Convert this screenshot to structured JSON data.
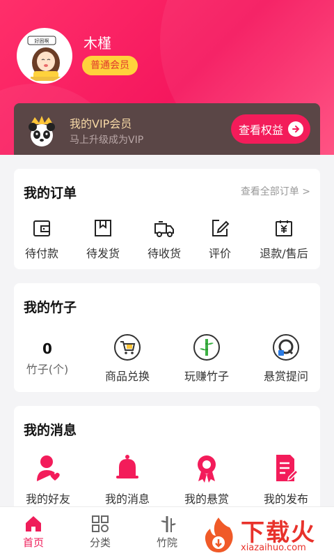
{
  "profile": {
    "username": "木槿",
    "level_badge": "普通会员",
    "avatar_caption": "好困啊"
  },
  "vip": {
    "title": "我的VIP会员",
    "subtitle": "马上升级成为VIP",
    "button_label": "查看权益"
  },
  "orders": {
    "title": "我的订单",
    "view_all": "查看全部订单 >",
    "items": [
      {
        "label": "待付款",
        "icon": "wallet-icon"
      },
      {
        "label": "待发货",
        "icon": "package-icon"
      },
      {
        "label": "待收货",
        "icon": "truck-icon"
      },
      {
        "label": "评价",
        "icon": "edit-icon"
      },
      {
        "label": "退款/售后",
        "icon": "refund-icon"
      }
    ]
  },
  "bamboo": {
    "title": "我的竹子",
    "count": "0",
    "count_label": "竹子(个)",
    "items": [
      {
        "label": "商品兑换",
        "icon": "cart-icon"
      },
      {
        "label": "玩赚竹子",
        "icon": "bamboo-icon"
      },
      {
        "label": "悬赏提问",
        "icon": "question-icon"
      }
    ]
  },
  "messages": {
    "title": "我的消息",
    "items": [
      {
        "label": "我的好友",
        "icon": "friend-icon"
      },
      {
        "label": "我的消息",
        "icon": "bell-icon"
      },
      {
        "label": "我的悬赏",
        "icon": "reward-icon"
      },
      {
        "label": "我的发布",
        "icon": "publish-icon"
      }
    ]
  },
  "tabbar": {
    "items": [
      {
        "label": "首页",
        "icon": "home-icon",
        "active": true
      },
      {
        "label": "分类",
        "icon": "category-icon",
        "active": false
      },
      {
        "label": "竹院",
        "icon": "bamboo-yard-icon",
        "active": false
      }
    ]
  },
  "watermark": {
    "brand": "下载火",
    "url": "xiazaihuo.com"
  },
  "colors": {
    "accent": "#f31c5a",
    "vip_bg": "#5a4646",
    "vip_gold": "#f7d9a6",
    "badge_yellow": "#ffd23c"
  }
}
